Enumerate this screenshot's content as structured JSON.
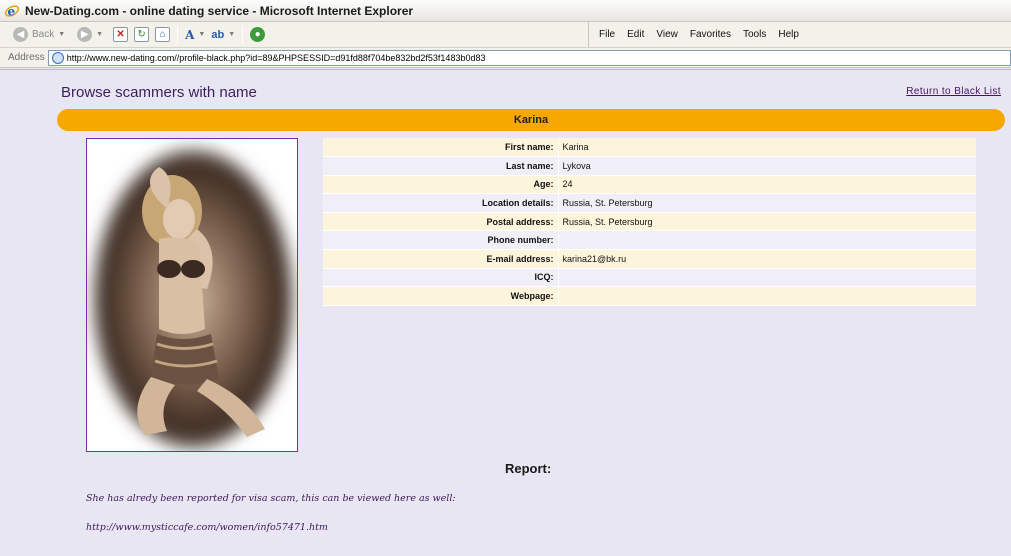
{
  "window": {
    "title": "New-Dating.com - online dating service - Microsoft Internet Explorer"
  },
  "toolbar": {
    "back_label": "Back",
    "menu": [
      "File",
      "Edit",
      "View",
      "Favorites",
      "Tools",
      "Help"
    ]
  },
  "address": {
    "label": "Address",
    "url": "http://www.new-dating.com//profile-black.php?id=89&PHPSESSID=d91fd88f704be832bd2f53f1483b0d83"
  },
  "page": {
    "heading": "Browse scammers with name",
    "return_link": "Return to Black List",
    "profile_name": "Karina"
  },
  "profile": [
    {
      "label": "First name:",
      "value": "Karina"
    },
    {
      "label": "Last name:",
      "value": "Lykova"
    },
    {
      "label": "Age:",
      "value": "24"
    },
    {
      "label": "Location details:",
      "value": "Russia, St. Petersburg"
    },
    {
      "label": "Postal address:",
      "value": "Russia, St. Petersburg"
    },
    {
      "label": "Phone number:",
      "value": ""
    },
    {
      "label": "E-mail address:",
      "value": "karina21@bk.ru"
    },
    {
      "label": "ICQ:",
      "value": ""
    },
    {
      "label": "Webpage:",
      "value": ""
    }
  ],
  "report": {
    "title": "Report:",
    "text": "She has alredy been reported for visa scam, this can be viewed here as well:",
    "link": "http://www.mysticcafe.com/women/info57471.htm"
  },
  "colors": {
    "page_bg": "#e9e6f3",
    "name_bar": "#f6a800",
    "heading": "#3c1e5a",
    "photo_border": "#7b2fa8"
  }
}
